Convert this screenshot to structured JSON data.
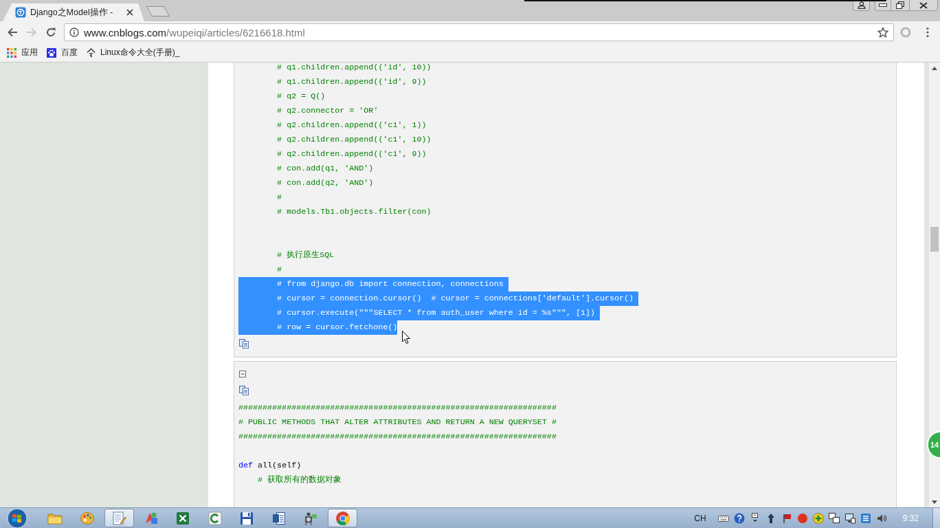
{
  "browser": {
    "tabs": [
      {
        "title": "Django之Model操作 -",
        "selected": true
      }
    ],
    "nav_buttons": [
      {
        "kind": "back",
        "disabled": false
      },
      {
        "kind": "forward",
        "disabled": true
      },
      {
        "kind": "reload",
        "disabled": false
      }
    ],
    "address_bar": {
      "host": "www.cnblogs.com",
      "path": "/wupeiqi/articles/6216618.html"
    },
    "bookmarks": [
      {
        "kind": "apps",
        "label": "应用"
      },
      {
        "kind": "paw",
        "label": "百度"
      },
      {
        "kind": "page",
        "label": "Linux命令大全(手册)_"
      }
    ]
  },
  "article": {
    "code_blocks": [
      {
        "items": [
          {
            "kind": "code",
            "selected": false,
            "segments": [
              {
                "kind": "comment",
                "text": "        # q1.children.append(('id', 10))"
              }
            ]
          },
          {
            "kind": "code",
            "selected": false,
            "segments": [
              {
                "kind": "comment",
                "text": "        # q1.children.append(('id', 9))"
              }
            ]
          },
          {
            "kind": "code",
            "selected": false,
            "segments": [
              {
                "kind": "comment",
                "text": "        # q2 = Q()"
              }
            ]
          },
          {
            "kind": "code",
            "selected": false,
            "segments": [
              {
                "kind": "comment",
                "text": "        # q2.connector = 'OR'"
              }
            ]
          },
          {
            "kind": "code",
            "selected": false,
            "segments": [
              {
                "kind": "comment",
                "text": "        # q2.children.append(('c1', 1))"
              }
            ]
          },
          {
            "kind": "code",
            "selected": false,
            "segments": [
              {
                "kind": "comment",
                "text": "        # q2.children.append(('c1', 10))"
              }
            ]
          },
          {
            "kind": "code",
            "selected": false,
            "segments": [
              {
                "kind": "comment",
                "text": "        # q2.children.append(('c1', 9))"
              }
            ]
          },
          {
            "kind": "code",
            "selected": false,
            "segments": [
              {
                "kind": "comment",
                "text": "        # con.add(q1, 'AND')"
              }
            ]
          },
          {
            "kind": "code",
            "selected": false,
            "segments": [
              {
                "kind": "comment",
                "text": "        # con.add(q2, 'AND')"
              }
            ]
          },
          {
            "kind": "code",
            "selected": false,
            "segments": [
              {
                "kind": "comment",
                "text": "        #"
              }
            ]
          },
          {
            "kind": "code",
            "selected": false,
            "segments": [
              {
                "kind": "comment",
                "text": "        # models.Tb1.objects.filter(con)"
              }
            ]
          },
          {
            "kind": "blank"
          },
          {
            "kind": "blank"
          },
          {
            "kind": "code",
            "selected": false,
            "segments": [
              {
                "kind": "comment",
                "text": "        # 执行原生SQL"
              }
            ]
          },
          {
            "kind": "code",
            "selected": false,
            "segments": [
              {
                "kind": "comment",
                "text": "        #"
              }
            ]
          },
          {
            "kind": "code",
            "selected": true,
            "segments": [
              {
                "kind": "comment",
                "text": "        # from django.db import connection, connections"
              }
            ]
          },
          {
            "kind": "code",
            "selected": true,
            "segments": [
              {
                "kind": "comment",
                "text": "        # cursor = connection.cursor()  # cursor = connections['default'].cursor()"
              }
            ]
          },
          {
            "kind": "code",
            "selected": true,
            "segments": [
              {
                "kind": "comment",
                "text": "        # cursor.execute(\"\"\"SELECT * from auth_user where id = %s\"\"\", [1])"
              }
            ]
          },
          {
            "kind": "code",
            "selected": true,
            "segments": [
              {
                "kind": "comment",
                "text": "        # row = cursor.fetchone()"
              }
            ]
          },
          {
            "kind": "copy"
          }
        ]
      },
      {
        "items": [
          {
            "kind": "toggle",
            "expanded": true
          },
          {
            "kind": "copy"
          },
          {
            "kind": "code",
            "selected": false,
            "segments": [
              {
                "kind": "comment",
                "text": "##################################################################"
              }
            ]
          },
          {
            "kind": "code",
            "selected": false,
            "segments": [
              {
                "kind": "comment",
                "text": "# PUBLIC METHODS THAT ALTER ATTRIBUTES AND RETURN A NEW QUERYSET #"
              }
            ]
          },
          {
            "kind": "code",
            "selected": false,
            "segments": [
              {
                "kind": "comment",
                "text": "##################################################################"
              }
            ]
          },
          {
            "kind": "blank"
          },
          {
            "kind": "code",
            "selected": false,
            "segments": [
              {
                "kind": "keyword",
                "text": "def"
              },
              {
                "kind": "plain",
                "text": " all(self)"
              }
            ]
          },
          {
            "kind": "code",
            "selected": false,
            "segments": [
              {
                "kind": "comment",
                "text": "    # 获取所有的数据对象"
              }
            ]
          },
          {
            "kind": "blank"
          }
        ]
      }
    ]
  },
  "side_badge": {
    "text": "14"
  },
  "taskbar": {
    "apps": [
      {
        "kind": "folder",
        "open": false
      },
      {
        "kind": "palette",
        "open": false
      },
      {
        "kind": "notepad",
        "open": true
      },
      {
        "kind": "shapes",
        "open": false
      },
      {
        "kind": "spreadsheet",
        "open": false
      },
      {
        "kind": "arc",
        "open": false
      },
      {
        "kind": "floppy",
        "open": false
      },
      {
        "kind": "document",
        "open": false
      },
      {
        "kind": "projector",
        "open": false
      },
      {
        "kind": "circle-logo",
        "open": true
      }
    ],
    "input_language": "CH",
    "clock": "9:32"
  }
}
